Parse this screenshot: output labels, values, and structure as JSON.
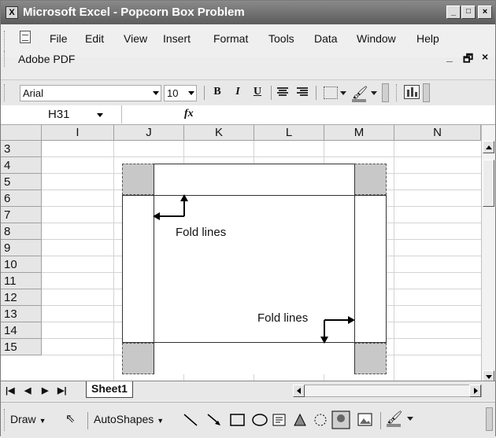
{
  "window": {
    "title": "Microsoft Excel - Popcorn Box Problem",
    "minimize": "_",
    "restore": "□",
    "close": "×"
  },
  "menu": {
    "items": [
      "File",
      "Edit",
      "View",
      "Insert",
      "Format",
      "Tools",
      "Data",
      "Window",
      "Help"
    ],
    "second_row": "Adobe PDF",
    "doc_controls": [
      "_",
      "ₔ",
      "×"
    ]
  },
  "format_toolbar": {
    "font": "Arial",
    "size": "10",
    "bold": "B",
    "italic": "I",
    "underline": "U"
  },
  "formula_bar": {
    "name_box": "H31",
    "fx": "fx"
  },
  "grid": {
    "columns": [
      "I",
      "J",
      "K",
      "L",
      "M",
      "N"
    ],
    "rows": [
      "3",
      "4",
      "5",
      "6",
      "7",
      "8",
      "9",
      "10",
      "11",
      "12",
      "13",
      "14",
      "15"
    ],
    "annotations": {
      "fold_label_1": "Fold lines",
      "fold_label_2": "Fold lines"
    }
  },
  "sheet_tabs": {
    "nav": [
      "|◀",
      "◀",
      "▶",
      "▶|"
    ],
    "active": "Sheet1"
  },
  "drawing_toolbar": {
    "draw": "Draw",
    "autoshapes": "AutoShapes"
  },
  "colors": {
    "title_bar": "#5c5c5c",
    "corner_cut": "#c8c8c8",
    "grid_line": "#d4d4d4"
  }
}
